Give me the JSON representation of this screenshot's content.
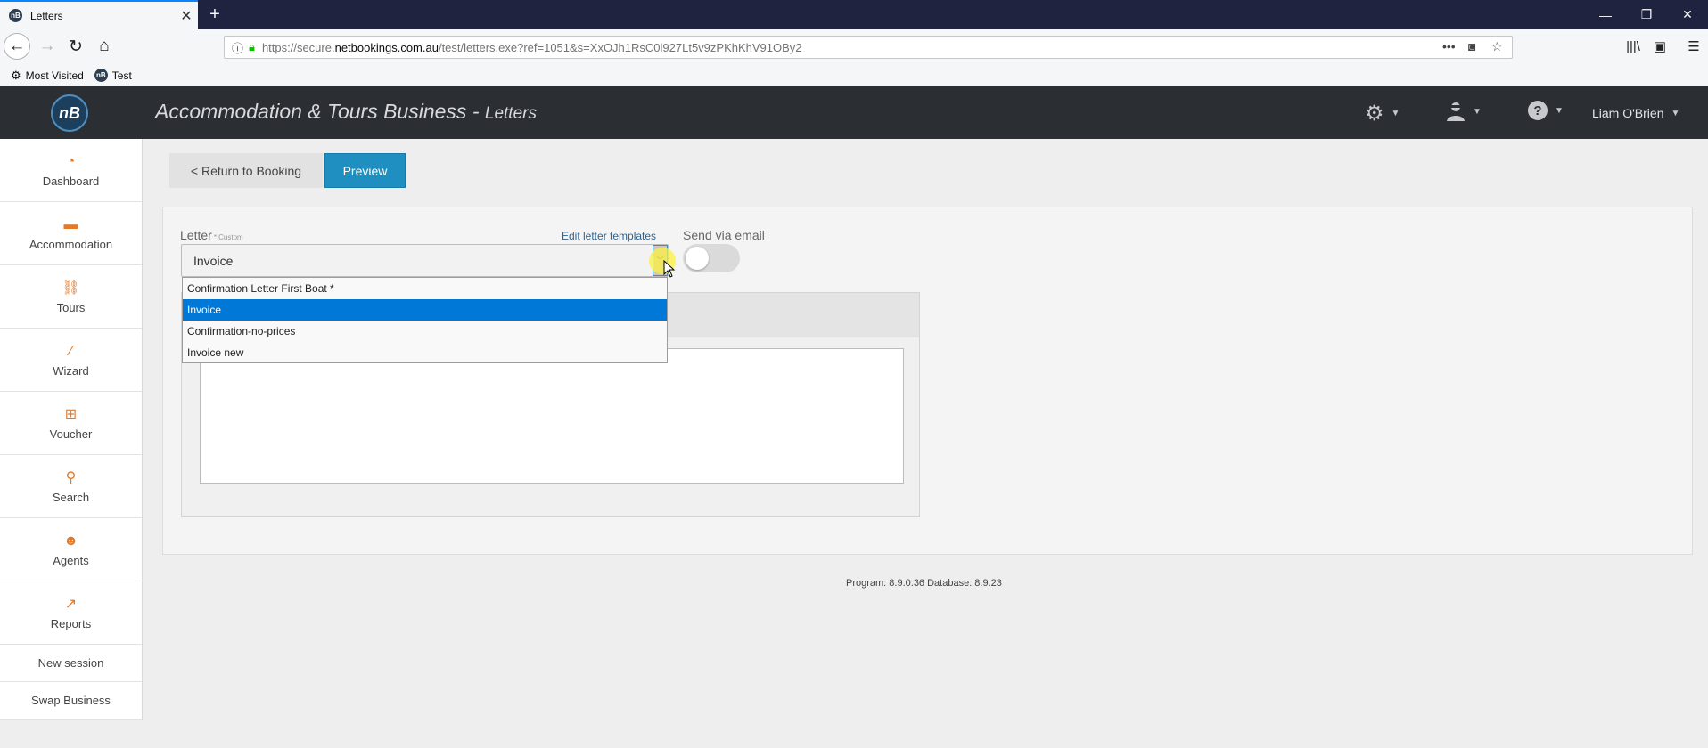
{
  "browser": {
    "tab_title": "Letters",
    "tab_favicon": "nB",
    "url_prefix": "https://secure.",
    "url_domain": "netbookings.com.au",
    "url_path": "/test/letters.exe?ref=1051&s=XxOJh1RsC0l927Lt5v9zPKhKhV91OBy2",
    "bookmarks": [
      {
        "label": "Most Visited",
        "icon": "gear-icon"
      },
      {
        "label": "Test",
        "icon": "nb-favicon"
      }
    ]
  },
  "header": {
    "logo": "nB",
    "title": "Accommodation & Tours Business - ",
    "subtitle": "Letters",
    "user_name": "Liam O'Brien",
    "icons": [
      "settings-gear-icon",
      "agent-icon",
      "help-icon"
    ]
  },
  "sidebar": {
    "items": [
      {
        "label": "Dashboard",
        "icon": "dashboard-icon"
      },
      {
        "label": "Accommodation",
        "icon": "bed-icon"
      },
      {
        "label": "Tours",
        "icon": "tours-icon"
      },
      {
        "label": "Wizard",
        "icon": "wand-icon"
      },
      {
        "label": "Voucher",
        "icon": "gift-icon"
      },
      {
        "label": "Search",
        "icon": "search-icon"
      },
      {
        "label": "Agents",
        "icon": "agent-icon"
      },
      {
        "label": "Reports",
        "icon": "chart-icon"
      }
    ],
    "links": [
      "New session",
      "Swap Business"
    ]
  },
  "toolbar": {
    "return_label": "< Return to Booking",
    "preview_label": "Preview"
  },
  "form": {
    "letter_label": "Letter",
    "letter_hint": "* Custom",
    "edit_templates": "Edit letter templates",
    "send_via_email": "Send via email",
    "send_via_email_on": false,
    "selected_letter": "Invoice",
    "options": [
      "Confirmation Letter First Boat *",
      "Invoice",
      "Confirmation-no-prices",
      "Invoice new"
    ],
    "selected_index": 1
  },
  "footer": {
    "version": "Program: 8.9.0.36 Database: 8.9.23"
  },
  "colors": {
    "header_bg": "#2b2e33",
    "accent": "#1e8fc0",
    "sidebar_icon": "#e07a2c",
    "selected_option": "#0078d7"
  }
}
